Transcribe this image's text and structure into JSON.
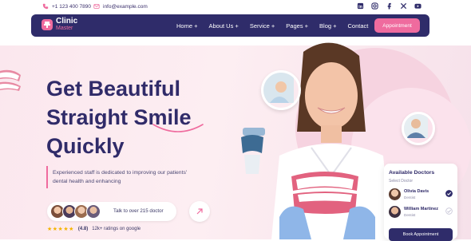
{
  "topbar": {
    "phone": "+1 123 400 7890",
    "email": "info@example.com",
    "socials": [
      "linkedin-icon",
      "instagram-icon",
      "facebook-icon",
      "x-icon",
      "youtube-icon"
    ]
  },
  "nav": {
    "logo_line1": "Clinic",
    "logo_line2": "Master",
    "items": [
      "Home +",
      "About Us +",
      "Service +",
      "Pages +",
      "Blog +",
      "Contact"
    ],
    "cta": "Appointment"
  },
  "hero": {
    "title_line1": "Get Beautiful",
    "title_line2": "Straight Smile",
    "title_line3": "Quickly",
    "description_line1": "Experienced staff is dedicated to improving our patients'",
    "description_line2": "dental health and enhancing",
    "talk_text": "Talk to over 215 doctor",
    "rating_score": "(4.8)",
    "rating_text": "12k+ ratings on google"
  },
  "doctors_card": {
    "title": "Available Doctors",
    "subtitle": "Select Doctor",
    "doctors": [
      {
        "name": "Olivia Davis",
        "role": "Dentist"
      },
      {
        "name": "William Martinez",
        "role": "Dentist"
      }
    ],
    "button": "Book Appointment"
  },
  "colors": {
    "navy": "#2f2c6a",
    "pink": "#ef6b9e",
    "hero_bg": "#fbe7ee"
  }
}
